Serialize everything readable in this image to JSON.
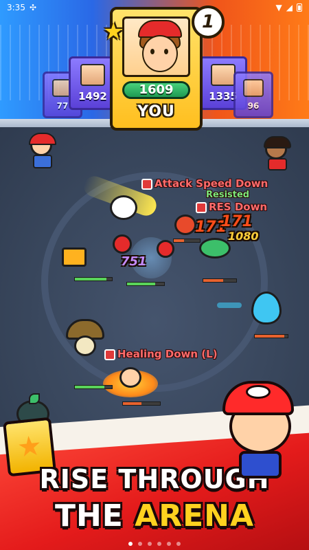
{
  "status_bar": {
    "time": "3:35",
    "notification_icon": "game-controller-icon"
  },
  "leaderboard": {
    "player": {
      "rank": "1",
      "score": "1609",
      "label": "YOU"
    },
    "left_cards": [
      {
        "score": "1492"
      },
      {
        "score": "77"
      }
    ],
    "right_cards": [
      {
        "score": "1335"
      },
      {
        "score": "96"
      }
    ]
  },
  "battle": {
    "effects": {
      "attack_speed_down": "Attack Speed Down",
      "resisted": "Resisted",
      "res_down": "RES Down",
      "healing_down": "Healing Down (L)"
    },
    "damage_numbers": [
      "171",
      "171",
      "1080",
      "751"
    ]
  },
  "promo": {
    "line1": "RISE THROUGH",
    "line2_prefix": "THE ",
    "line2_highlight": "ARENA"
  },
  "pager": {
    "count": 6,
    "active_index": 0
  }
}
